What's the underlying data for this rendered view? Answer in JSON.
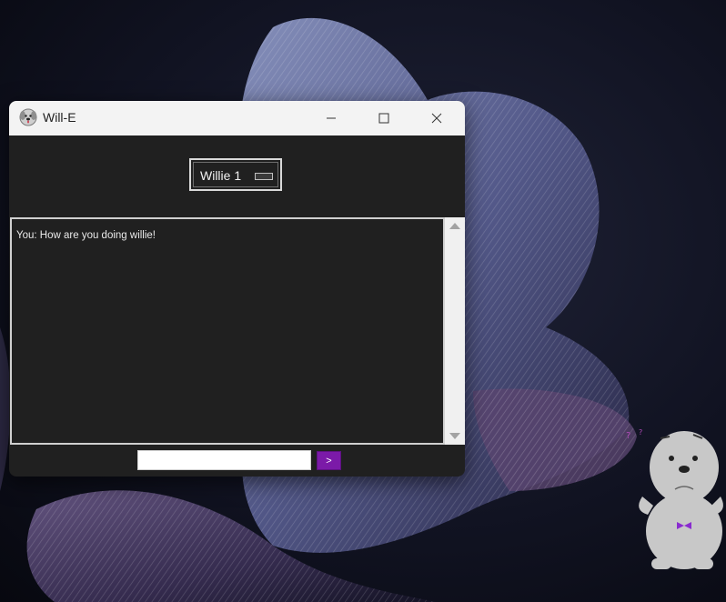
{
  "window": {
    "title": "Will-E"
  },
  "model_selector": {
    "selected": "Willie 1"
  },
  "chat": {
    "messages": [
      "You: How are you doing willie!"
    ]
  },
  "input": {
    "value": "",
    "placeholder": ""
  },
  "send_button": {
    "label": ">"
  },
  "colors": {
    "accent": "#7b1aa8",
    "window_bg": "#202020",
    "titlebar_bg": "#f3f3f3"
  },
  "icons": {
    "app": "dog-face-icon",
    "minimize": "minimize-icon",
    "maximize": "maximize-icon",
    "close": "close-icon",
    "desktop_mascot": "sea-lion-mascot-icon"
  }
}
